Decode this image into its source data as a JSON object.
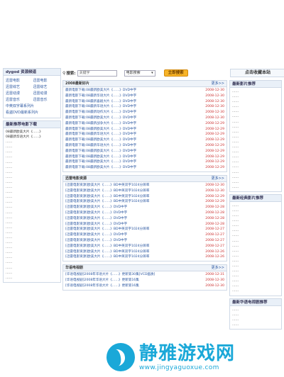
{
  "header": {
    "site_name": "dygod 资源频道",
    "search_label": "搜索:",
    "search_value": "关键字",
    "search_select": "电影搜索",
    "search_button": "立即搜索",
    "favorite": "点击收藏本站"
  },
  "nav": {
    "items": [
      "迅雷电影",
      "迅雷电影",
      "迅雷综艺",
      "迅雷综艺",
      "迅雷动漫",
      "迅雷动漫",
      "迅雷音乐",
      "迅雷音乐"
    ],
    "extra": [
      "中英双字幕系列片",
      "看盗DVD最新系列片"
    ]
  },
  "left_recommend": {
    "title": "最新推荐电影下载",
    "rows": [
      "08最新欧美大片《……》",
      "08最新华语大片《……》",
      "……",
      "……",
      "……",
      "……",
      "……",
      "……",
      "……",
      "……",
      "……",
      "……",
      "……",
      "……",
      "……",
      "……",
      "……",
      "……",
      "……",
      "……",
      "……",
      "……",
      "……",
      "……",
      "……",
      "……",
      "……",
      "……",
      "……",
      "……"
    ]
  },
  "panels": [
    {
      "title": "2008最新好片",
      "more": "更多>>",
      "rows": [
        {
          "t": "最新电影下载:08最新欧美大片《……》DVD中字",
          "d": "2008-12-30"
        },
        {
          "t": "最新电影下载:08最新华语大片《……》DVD中字",
          "d": "2008-12-30"
        },
        {
          "t": "最新电影下载:08最新喜剧大片《……》DVD中字",
          "d": "2008-12-30"
        },
        {
          "t": "最新电影下载:08最新华语大片《……》DVD中字",
          "d": "2008-12-30"
        },
        {
          "t": "最新电影下载:08最新动作大片《……》DVD中字",
          "d": "2008-12-30"
        },
        {
          "t": "最新电影下载:08最新欧美大片《……》DVD中字",
          "d": "2008-12-30"
        },
        {
          "t": "最新电影下载:08最新战争大片《……》DVD中字",
          "d": "2008-12-29"
        },
        {
          "t": "最新电影下载:08最新欧美大片《……》DVD中字",
          "d": "2008-12-29"
        },
        {
          "t": "最新电影下载:08最新华语大片《……》DVD中字",
          "d": "2008-12-29"
        },
        {
          "t": "最新电影下载:08最新欧美大片《……》DVD中字",
          "d": "2008-12-29"
        },
        {
          "t": "最新电影下载:08最新华语大片《……》DVD中字",
          "d": "2008-12-29"
        },
        {
          "t": "最新电影下载:08最新欧美大片《……》DVD中字",
          "d": "2008-12-29"
        },
        {
          "t": "最新电影下载:08最新欧美大片《……》DVD中字",
          "d": "2008-12-29"
        },
        {
          "t": "最新电影下载:08最新欧美大片《……》DVD中字",
          "d": "2008-12-29"
        },
        {
          "t": "最新电影下载:08最新欧美大片《……》DVD中字",
          "d": "2008-12-29"
        }
      ]
    },
    {
      "title": "迅雷电影资源",
      "more": "更多>>",
      "rows": [
        {
          "t": "[迅雷电影资源]欧美大片《……》BD中英双字1024分辨率",
          "d": "2008-12-30"
        },
        {
          "t": "[迅雷电影资源]欧美大片《……》BD中英双字1024分辨率",
          "d": "2008-12-30"
        },
        {
          "t": "[迅雷电影资源]欧美大片《……》BD中英双字1024分辨率",
          "d": "2008-12-29"
        },
        {
          "t": "[迅雷电影资源]欧美大片《……》BD中英双字1024分辨率",
          "d": "2008-12-29"
        },
        {
          "t": "[迅雷电影资源]欧美大片《……》DVD中字",
          "d": "2008-12-28"
        },
        {
          "t": "[迅雷电影资源]欧美大片《……》DVD中字",
          "d": "2008-12-28"
        },
        {
          "t": "[迅雷电影资源]欧美大片《……》DVD中字",
          "d": "2008-12-28"
        },
        {
          "t": "[迅雷电影资源]欧美大片《……》DVD中字",
          "d": "2008-12-28"
        },
        {
          "t": "[迅雷电影资源]欧美大片《……》BD中英双字1024分辨率",
          "d": "2008-12-27"
        },
        {
          "t": "[迅雷电影资源]欧美大片《……》DVD中字",
          "d": "2008-12-27"
        },
        {
          "t": "[迅雷电影资源]欧美大片《……》DVD中字",
          "d": "2008-12-27"
        },
        {
          "t": "[迅雷电影资源]欧美大片《……》BD中英双字1024分辨率",
          "d": "2008-12-27"
        },
        {
          "t": "[迅雷电影资源]欧美大片《……》BD中英双字1024分辨率",
          "d": "2008-12-26"
        },
        {
          "t": "[迅雷电影资源]欧美大片《……》BD中英双字1024分辨率",
          "d": "2008-12-26"
        }
      ]
    },
    {
      "title": "华语电视剧",
      "more": "更多>>",
      "rows": [
        {
          "t": "[华语电视剧]2008年华语大片《……》更新第30集[VCD画质]",
          "d": "2008-12-31"
        },
        {
          "t": "[华语电视剧]2008年华语大片《……》更新第16集",
          "d": "2008-12-30"
        },
        {
          "t": "[华语电视剧]2008年华语大片《……》更新第16集",
          "d": "2008-12-30"
        }
      ]
    }
  ],
  "right_boxes": [
    {
      "title": "最新影片推荐",
      "rows": [
        "……",
        "……",
        "……",
        "……",
        "……",
        "……",
        "……",
        "……",
        "……",
        "……",
        "……",
        "……",
        "……",
        "……",
        "……",
        "……",
        "……",
        "……",
        "……",
        "……"
      ]
    },
    {
      "title": "最新经典影片推荐",
      "rows": [
        "……",
        "……",
        "……",
        "……",
        "……",
        "……",
        "……",
        "……",
        "……",
        "……",
        "……",
        "……",
        "……",
        "……",
        "……",
        "……",
        "……",
        "……"
      ]
    },
    {
      "title": "最新华语电视剧推荐",
      "rows": [
        "……",
        "……",
        "……",
        "……"
      ]
    }
  ],
  "watermark": {
    "cn": "静雅游戏网",
    "url": "www.jingyaguoxue.com"
  }
}
